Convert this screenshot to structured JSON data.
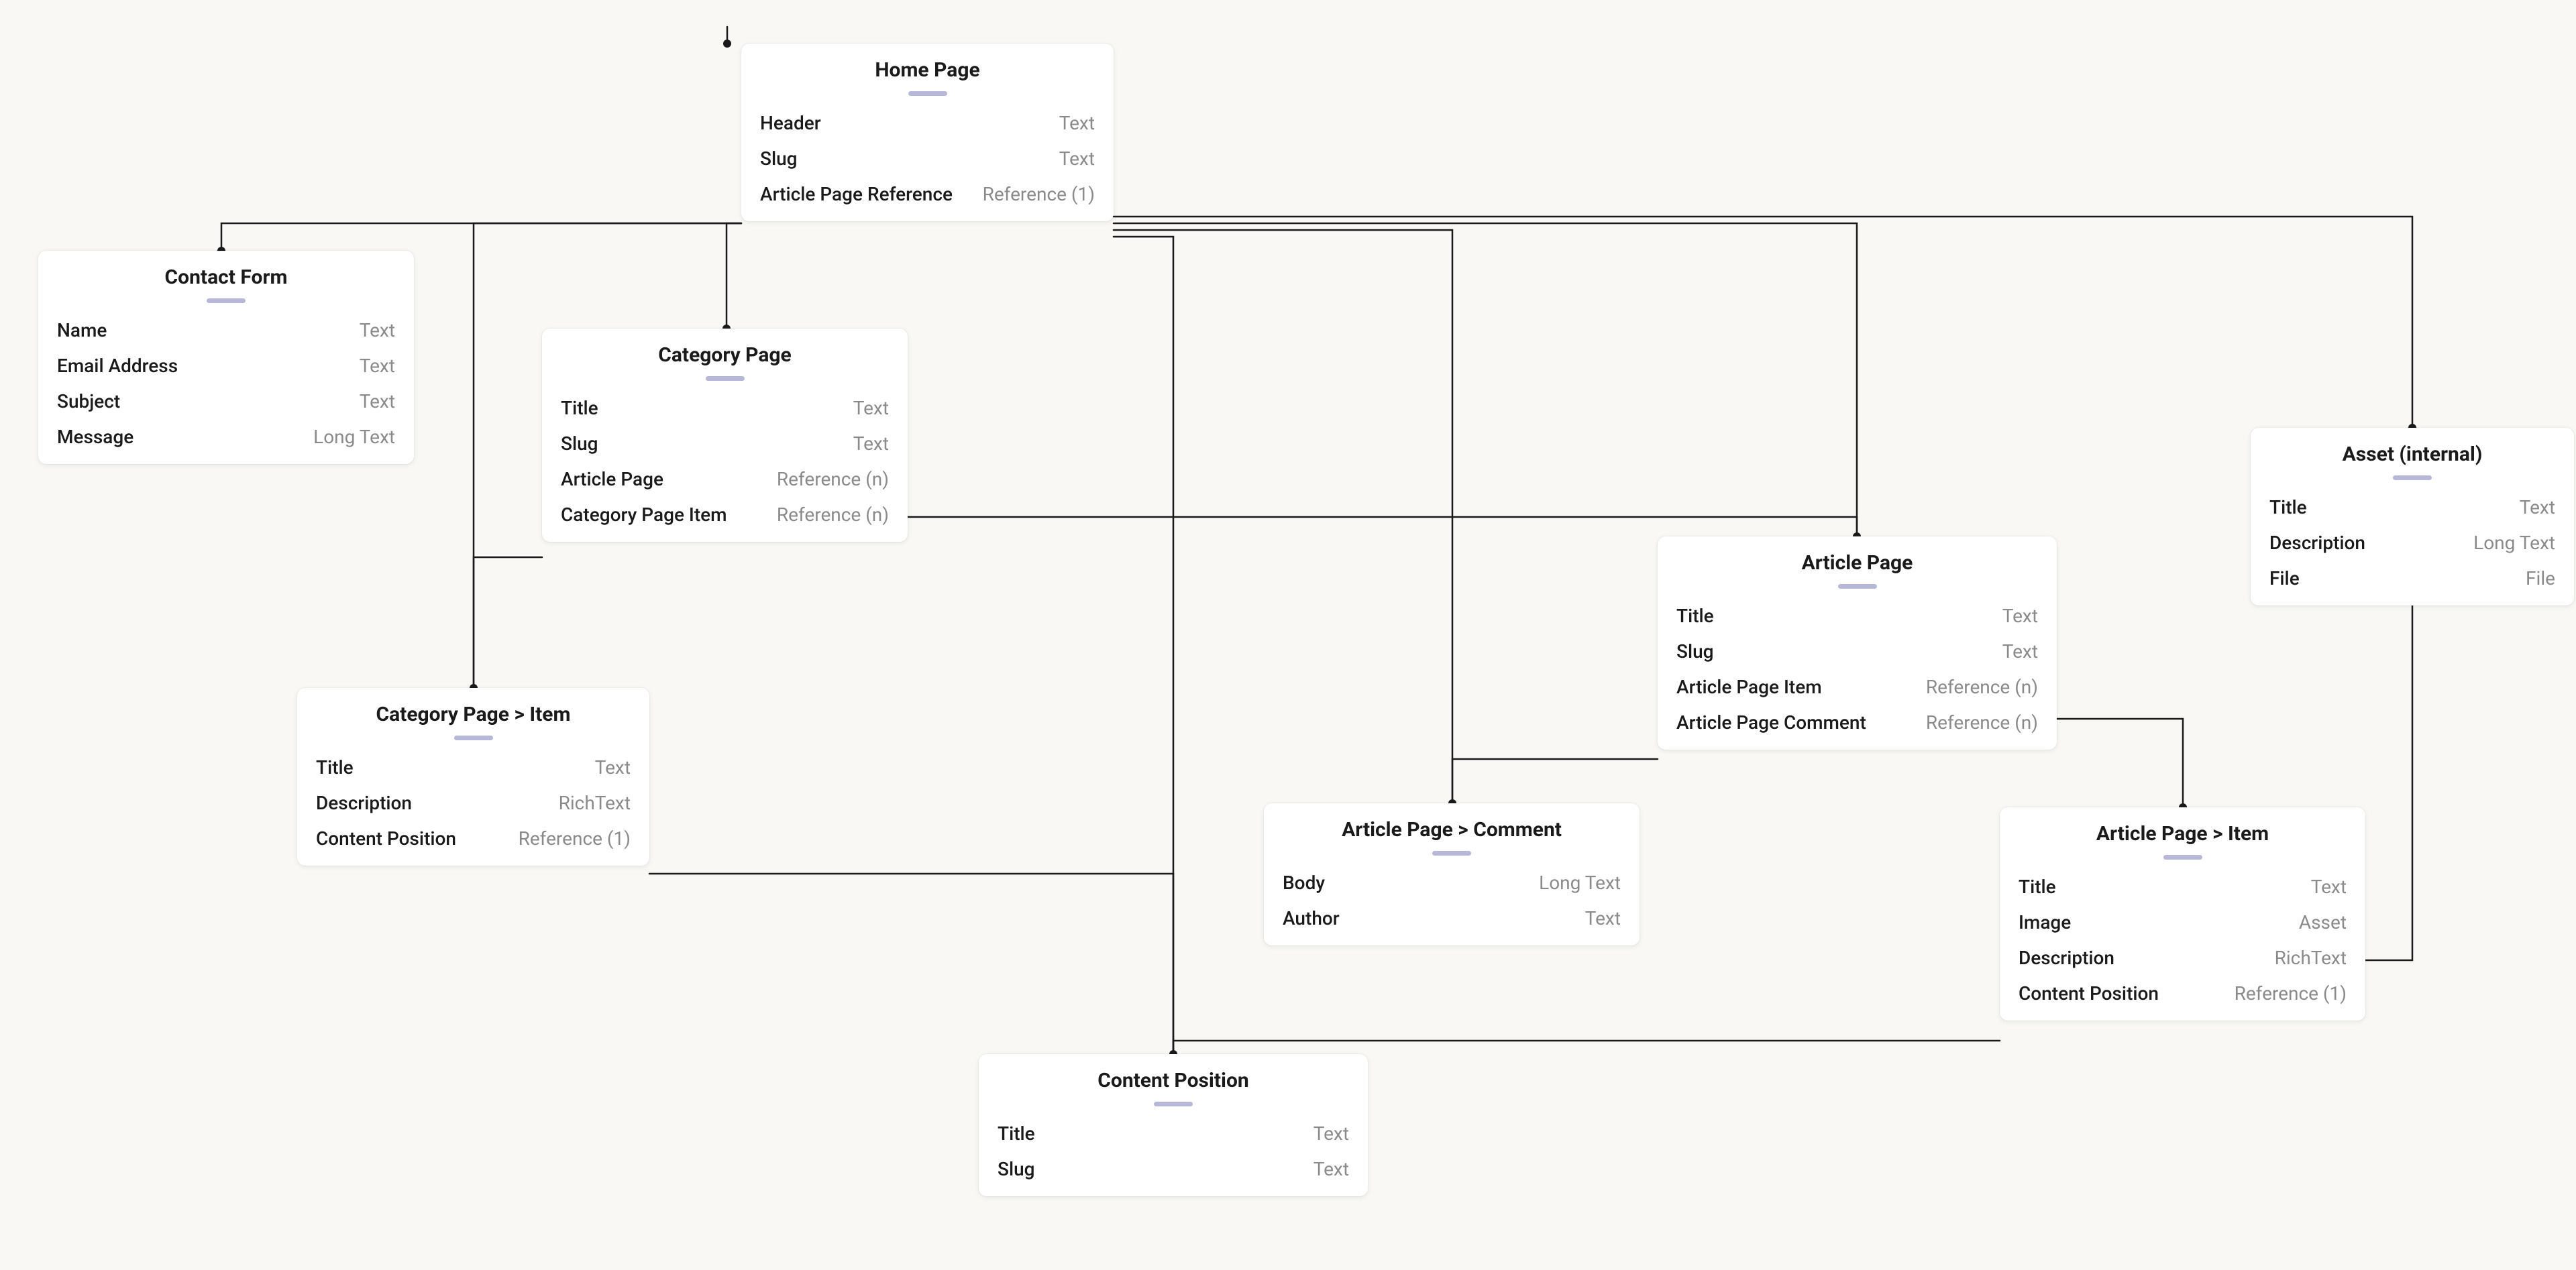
{
  "nodes": {
    "home_page": {
      "title": "Home Page",
      "fields": [
        {
          "name": "Header",
          "type": "Text"
        },
        {
          "name": "Slug",
          "type": "Text"
        },
        {
          "name": "Article Page Reference",
          "type": "Reference (1)"
        }
      ]
    },
    "contact_form": {
      "title": "Contact Form",
      "fields": [
        {
          "name": "Name",
          "type": "Text"
        },
        {
          "name": "Email Address",
          "type": "Text"
        },
        {
          "name": "Subject",
          "type": "Text"
        },
        {
          "name": "Message",
          "type": "Long Text"
        }
      ]
    },
    "category_page": {
      "title": "Category Page",
      "fields": [
        {
          "name": "Title",
          "type": "Text"
        },
        {
          "name": "Slug",
          "type": "Text"
        },
        {
          "name": "Article Page",
          "type": "Reference (n)"
        },
        {
          "name": "Category Page Item",
          "type": "Reference (n)"
        }
      ]
    },
    "category_page_item": {
      "title": "Category Page > Item",
      "fields": [
        {
          "name": "Title",
          "type": "Text"
        },
        {
          "name": "Description",
          "type": "RichText"
        },
        {
          "name": "Content Position",
          "type": "Reference (1)"
        }
      ]
    },
    "article_page": {
      "title": "Article Page",
      "fields": [
        {
          "name": "Title",
          "type": "Text"
        },
        {
          "name": "Slug",
          "type": "Text"
        },
        {
          "name": "Article Page Item",
          "type": "Reference (n)"
        },
        {
          "name": "Article Page Comment",
          "type": "Reference (n)"
        }
      ]
    },
    "article_page_comment": {
      "title": "Article Page > Comment",
      "fields": [
        {
          "name": "Body",
          "type": "Long Text"
        },
        {
          "name": "Author",
          "type": "Text"
        }
      ]
    },
    "article_page_item": {
      "title": "Article Page > Item",
      "fields": [
        {
          "name": "Title",
          "type": "Text"
        },
        {
          "name": "Image",
          "type": "Asset"
        },
        {
          "name": "Description",
          "type": "RichText"
        },
        {
          "name": "Content Position",
          "type": "Reference (1)"
        }
      ]
    },
    "asset_internal": {
      "title": "Asset (internal)",
      "fields": [
        {
          "name": "Title",
          "type": "Text"
        },
        {
          "name": "Description",
          "type": "Long Text"
        },
        {
          "name": "File",
          "type": "File"
        }
      ]
    },
    "content_position": {
      "title": "Content Position",
      "fields": [
        {
          "name": "Title",
          "type": "Text"
        },
        {
          "name": "Slug",
          "type": "Text"
        }
      ]
    }
  }
}
